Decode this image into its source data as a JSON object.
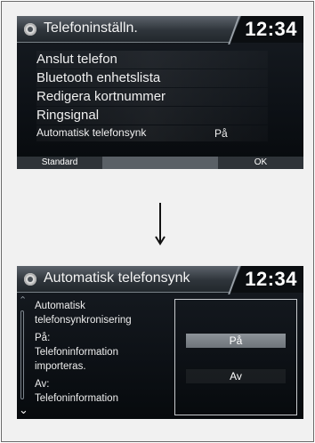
{
  "screen1": {
    "title": "Telefoninställn.",
    "clock": "12:34",
    "menu_items": [
      {
        "label": "Anslut telefon"
      },
      {
        "label": "Bluetooth enhetslista"
      },
      {
        "label": "Redigera kortnummer"
      },
      {
        "label": "Ringsignal"
      },
      {
        "label": "Automatisk telefonsynk",
        "value": "På"
      }
    ],
    "softkeys": {
      "left": "Standard",
      "right": "OK"
    }
  },
  "screen2": {
    "title": "Automatisk telefonsynk",
    "clock": "12:34",
    "description_lines": [
      "Automatisk",
      "telefonsynkronisering",
      "På:",
      "Telefoninformation",
      "importeras.",
      "Av:",
      "Telefoninformation"
    ],
    "options": [
      {
        "label": "På",
        "selected": true
      },
      {
        "label": "Av",
        "selected": false
      }
    ]
  },
  "icons": {
    "settings": "gear-icon",
    "transition": "arrow-down-icon",
    "scroll_up": "chevron-up-icon",
    "scroll_down": "chevron-down-icon"
  }
}
